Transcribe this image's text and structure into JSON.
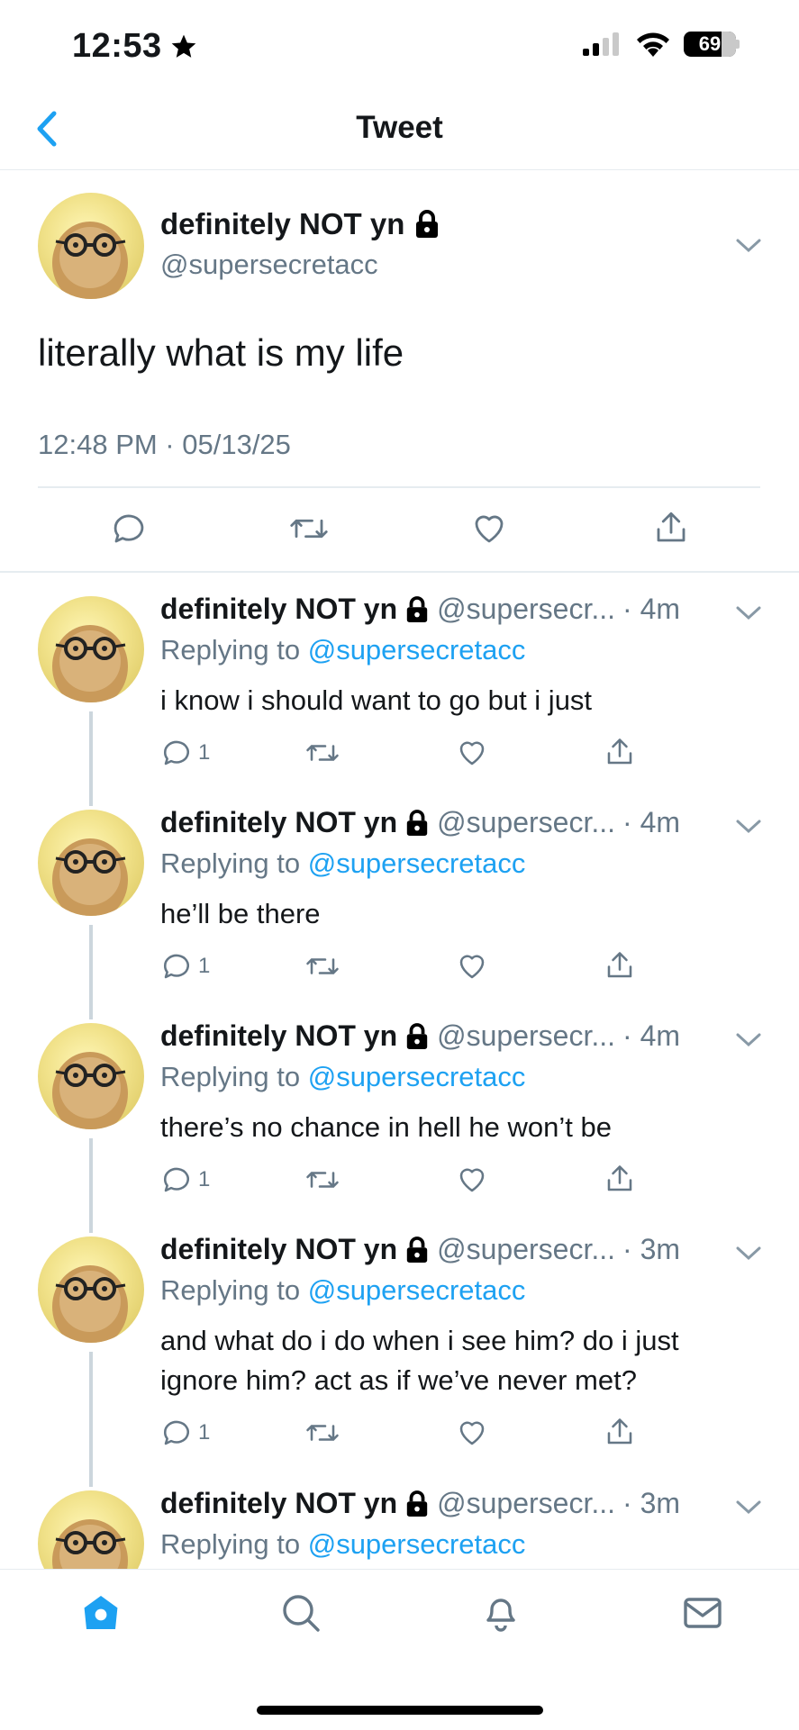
{
  "status_bar": {
    "time": "12:53",
    "battery": "69"
  },
  "header": {
    "title": "Tweet"
  },
  "main_tweet": {
    "name": "definitely NOT yn",
    "handle": "@supersecretacc",
    "text": "literally what is my life",
    "timestamp": "12:48 PM · 05/13/25"
  },
  "replies": [
    {
      "name": "definitely NOT yn",
      "handle": "@supersecr...",
      "age": "· 4m",
      "replying_prefix": "Replying to ",
      "replying_to": "@supersecretacc",
      "text": "i know i should want to go but i just",
      "reply_count": "1"
    },
    {
      "name": "definitely NOT yn",
      "handle": "@supersecr...",
      "age": "· 4m",
      "replying_prefix": "Replying to ",
      "replying_to": "@supersecretacc",
      "text": "he’ll be there",
      "reply_count": "1"
    },
    {
      "name": "definitely NOT yn",
      "handle": "@supersecr...",
      "age": "· 4m",
      "replying_prefix": "Replying to ",
      "replying_to": "@supersecretacc",
      "text": "there’s no chance in hell he won’t be",
      "reply_count": "1"
    },
    {
      "name": "definitely NOT yn",
      "handle": "@supersecr...",
      "age": "· 3m",
      "replying_prefix": "Replying to ",
      "replying_to": "@supersecretacc",
      "text": "and what do i do when i see him? do i just ignore him? act as if we’ve never met?",
      "reply_count": "1"
    },
    {
      "name": "definitely NOT yn",
      "handle": "@supersecr...",
      "age": "· 3m",
      "replying_prefix": "Replying to ",
      "replying_to": "@supersecretacc"
    }
  ],
  "icons": {
    "back": "chevron-left-icon",
    "lock": "lock-icon",
    "more": "chevron-down-icon",
    "reply": "reply-icon",
    "retweet": "retweet-icon",
    "like": "heart-icon",
    "share": "share-icon",
    "nav": [
      "home-icon",
      "search-icon",
      "bell-icon",
      "mail-icon"
    ]
  },
  "colors": {
    "accent": "#1da1f2",
    "muted": "#657786",
    "text": "#14171a"
  }
}
